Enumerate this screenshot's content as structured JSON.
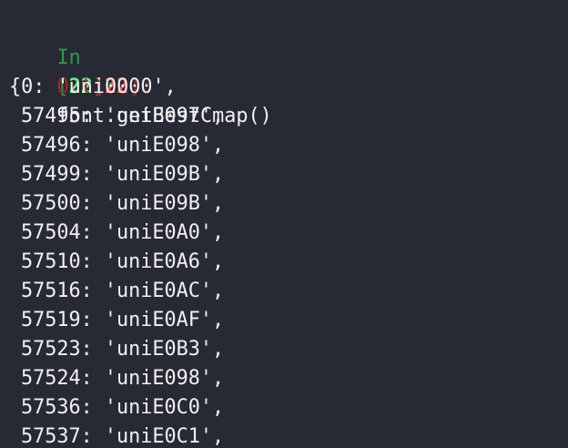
{
  "prompt_in": {
    "label": "In",
    "open_bracket": "[",
    "number": "22",
    "close_bracket": "]:",
    "code": "font.getBestCmap()"
  },
  "prompt_out": {
    "label": "Out",
    "open_bracket": "[",
    "number": "22",
    "close_bracket": "]:"
  },
  "output": {
    "first_line": "{0: 'uni0000',",
    "entries": [
      "57495: 'uniE097',",
      "57496: 'uniE098',",
      "57499: 'uniE09B',",
      "57500: 'uniE09B',",
      "57504: 'uniE0A0',",
      "57510: 'uniE0A6',",
      "57516: 'uniE0AC',",
      "57519: 'uniE0AF',",
      "57523: 'uniE0B3',",
      "57524: 'uniE098',",
      "57536: 'uniE0C0',",
      "57537: 'uniE0C1',"
    ]
  }
}
